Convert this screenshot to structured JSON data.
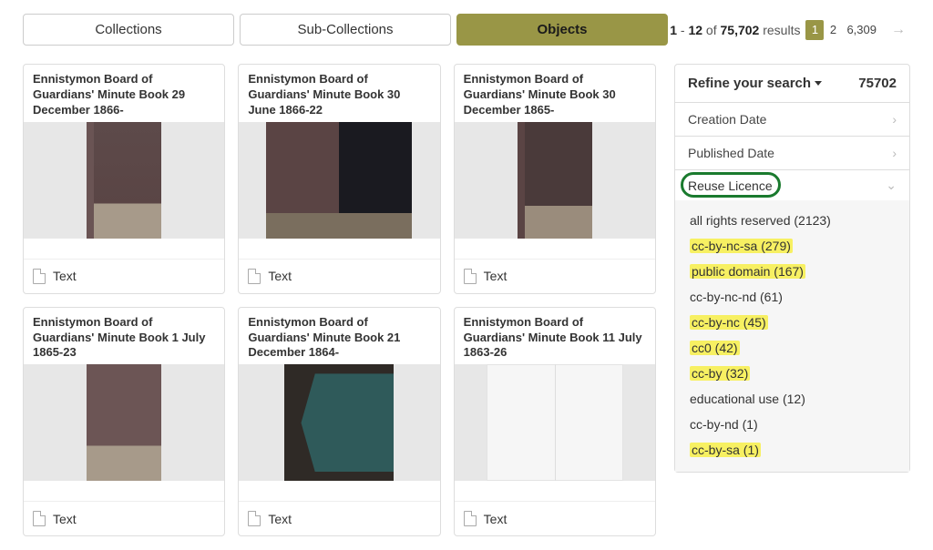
{
  "tabs": {
    "collections": "Collections",
    "sub": "Sub-Collections",
    "objects": "Objects"
  },
  "pager": {
    "from": "1",
    "to": "12",
    "total": "75,702",
    "results_word": "results",
    "pages": [
      "1",
      "2",
      "6,309"
    ],
    "active": "1"
  },
  "cards": [
    {
      "title": "Ennistymon Board of Guardians' Minute Book 29 December 1866-",
      "type": "Text",
      "img": "brown"
    },
    {
      "title": "Ennistymon Board of Guardians' Minute Book 30 June 1866-22",
      "type": "Text",
      "img": "split"
    },
    {
      "title": "Ennistymon Board of Guardians' Minute Book 30 December 1865-",
      "type": "Text",
      "img": "dark"
    },
    {
      "title": "Ennistymon Board of Guardians' Minute Book 1 July 1865-23",
      "type": "Text",
      "img": "light"
    },
    {
      "title": "Ennistymon Board of Guardians' Minute Book 21 December 1864-",
      "type": "Text",
      "img": "bluegreen"
    },
    {
      "title": "Ennistymon Board of Guardians' Minute Book 11 July 1863-26",
      "type": "Text",
      "img": "blank"
    }
  ],
  "refine": {
    "title": "Refine your search",
    "count": "75702",
    "facets_closed": [
      {
        "label": "Creation Date"
      },
      {
        "label": "Published Date"
      }
    ],
    "facet_open": {
      "label": "Reuse Licence",
      "options": [
        {
          "text": "all rights reserved (2123)",
          "hl": false
        },
        {
          "text": "cc-by-nc-sa (279)",
          "hl": true
        },
        {
          "text": "public domain (167)",
          "hl": true
        },
        {
          "text": "cc-by-nc-nd (61)",
          "hl": false
        },
        {
          "text": "cc-by-nc (45)",
          "hl": true
        },
        {
          "text": "cc0 (42)",
          "hl": true
        },
        {
          "text": "cc-by (32)",
          "hl": true
        },
        {
          "text": "educational use (12)",
          "hl": false
        },
        {
          "text": "cc-by-nd (1)",
          "hl": false
        },
        {
          "text": "cc-by-sa (1)",
          "hl": true
        }
      ]
    }
  }
}
